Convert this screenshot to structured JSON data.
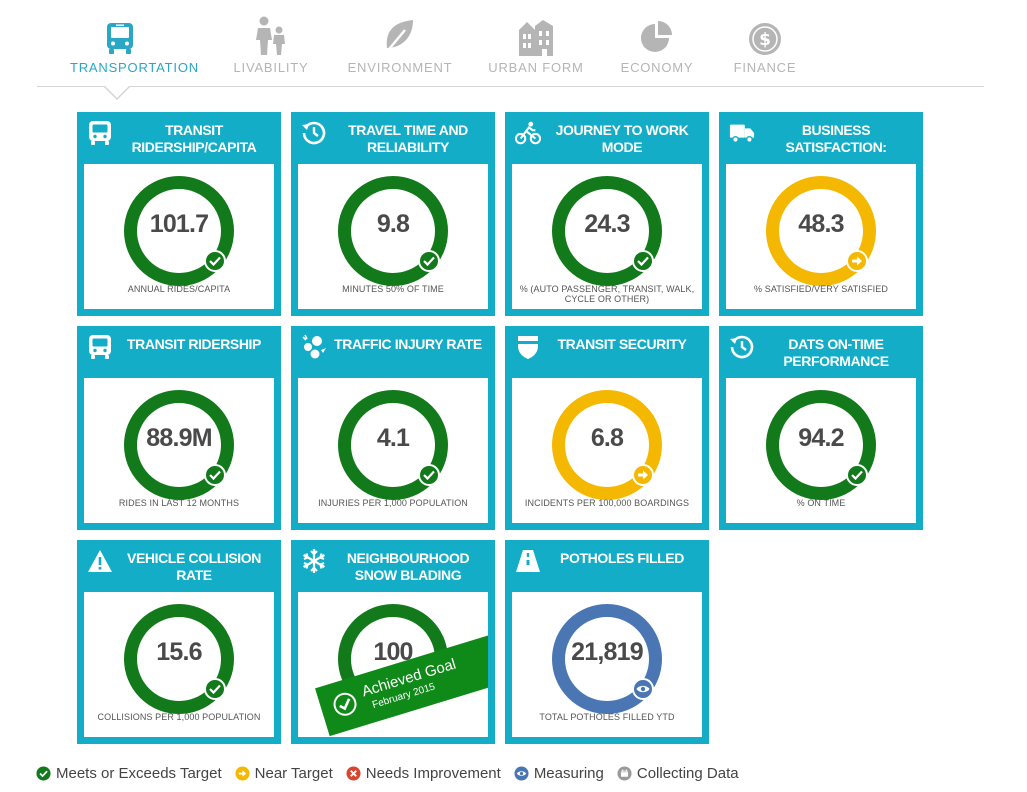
{
  "colors": {
    "tile_blue": "#13adc8",
    "active_tab": "#2aa7c4",
    "inactive_tab": "#b5b5b5",
    "meets_green": "#137a1c",
    "near_yellow": "#f5b800",
    "needs_red": "#d9442c",
    "measuring_blue": "#4a77b4",
    "collecting_gray": "#9a9a9a"
  },
  "nav": {
    "tabs": [
      {
        "label": "TRANSPORTATION",
        "icon": "bus-icon",
        "active": true
      },
      {
        "label": "LIVABILITY",
        "icon": "family-icon",
        "active": false
      },
      {
        "label": "ENVIRONMENT",
        "icon": "leaf-icon",
        "active": false
      },
      {
        "label": "URBAN FORM",
        "icon": "buildings-icon",
        "active": false
      },
      {
        "label": "ECONOMY",
        "icon": "pie-chart-icon",
        "active": false
      },
      {
        "label": "FINANCE",
        "icon": "dollar-coin-icon",
        "active": false
      }
    ]
  },
  "tiles": [
    {
      "title": "TRANSIT RIDERSHIP/CAPITA",
      "icon": "bus-icon",
      "value": "101.7",
      "caption": "ANNUAL RIDES/CAPITA",
      "status": "meets"
    },
    {
      "title": "TRAVEL TIME AND RELIABILITY",
      "icon": "clock-icon",
      "value": "9.8",
      "caption": "MINUTES 50% OF TIME",
      "status": "meets"
    },
    {
      "title": "JOURNEY TO WORK MODE",
      "icon": "cyclist-icon",
      "value": "24.3",
      "caption": "% (AUTO PASSENGER, TRANSIT, WALK, CYCLE OR OTHER)",
      "status": "meets"
    },
    {
      "title": "BUSINESS SATISFACTION:",
      "icon": "truck-icon",
      "value": "48.3",
      "caption": "% SATISFIED/VERY SATISFIED",
      "status": "near"
    },
    {
      "title": "TRANSIT RIDERSHIP",
      "icon": "bus-icon",
      "value": "88.9M",
      "caption": "RIDES IN LAST 12 MONTHS",
      "status": "meets"
    },
    {
      "title": "TRAFFIC INJURY RATE",
      "icon": "collision-icon",
      "value": "4.1",
      "caption": "INJURIES PER 1,000 POPULATION",
      "status": "meets"
    },
    {
      "title": "TRANSIT SECURITY",
      "icon": "shield-icon",
      "value": "6.8",
      "caption": "INCIDENTS PER 100,000 BOARDINGS",
      "status": "near"
    },
    {
      "title": "DATS ON-TIME PERFORMANCE",
      "icon": "clock-icon",
      "value": "94.2",
      "caption": "% ON TIME",
      "status": "meets"
    },
    {
      "title": "VEHICLE COLLISION RATE",
      "icon": "warning-icon",
      "value": "15.6",
      "caption": "COLLISIONS PER 1,000 POPULATION",
      "status": "meets"
    },
    {
      "title": "NEIGHBOURHOOD SNOW BLADING",
      "icon": "snowflake-icon",
      "value": "100",
      "caption": "",
      "status": "meets",
      "banner": {
        "title": "Achieved Goal",
        "subtitle": "February 2015"
      }
    },
    {
      "title": "POTHOLES FILLED",
      "icon": "road-icon",
      "value": "21,819",
      "caption": "TOTAL POTHOLES FILLED YTD",
      "status": "measuring"
    }
  ],
  "legend": [
    {
      "label": "Meets or Exceeds Target",
      "status": "meets"
    },
    {
      "label": "Near Target",
      "status": "near"
    },
    {
      "label": "Needs Improvement",
      "status": "needs"
    },
    {
      "label": "Measuring",
      "status": "measuring"
    },
    {
      "label": "Collecting Data",
      "status": "collecting"
    }
  ]
}
